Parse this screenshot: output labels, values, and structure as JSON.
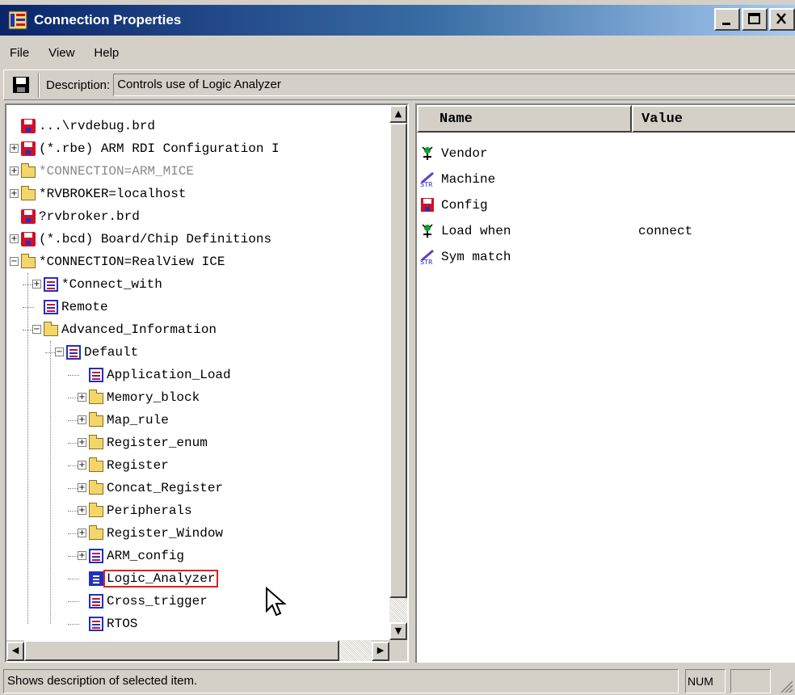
{
  "window": {
    "title": "Connection Properties"
  },
  "menu": [
    "File",
    "View",
    "Help"
  ],
  "toolbar": {
    "description_label": "Description:",
    "description_value": "Controls use of Logic Analyzer"
  },
  "tree": [
    {
      "label": "...\\rvdebug.brd",
      "icon": "red-board-icon",
      "depth": 0
    },
    {
      "label": "(*.rbe) ARM RDI Configuration I",
      "icon": "red-board-icon",
      "depth": 0,
      "expander": "+"
    },
    {
      "label": "*CONNECTION=ARM_MICE",
      "icon": "folder-icon",
      "depth": 0,
      "expander": "+",
      "grayed": true
    },
    {
      "label": "*RVBROKER=localhost",
      "icon": "folder-icon",
      "depth": 0,
      "expander": "+"
    },
    {
      "label": "?rvbroker.brd",
      "icon": "red-board-icon",
      "depth": 0
    },
    {
      "label": "(*.bcd) Board/Chip Definitions",
      "icon": "red-board-icon",
      "depth": 0,
      "expander": "+"
    },
    {
      "label": "*CONNECTION=RealView ICE",
      "icon": "folder-icon",
      "depth": 0,
      "expander": "-"
    },
    {
      "label": "*Connect_with",
      "icon": "document-icon",
      "depth": 1,
      "expander": "+"
    },
    {
      "label": "Remote",
      "icon": "document-icon",
      "depth": 1
    },
    {
      "label": "Advanced_Information",
      "icon": "folder-icon",
      "depth": 1,
      "expander": "-"
    },
    {
      "label": "Default",
      "icon": "document-icon",
      "depth": 2,
      "expander": "-"
    },
    {
      "label": "Application_Load",
      "icon": "document-icon",
      "depth": 3
    },
    {
      "label": "Memory_block",
      "icon": "folder-icon",
      "depth": 3,
      "expander": "+"
    },
    {
      "label": "Map_rule",
      "icon": "folder-icon",
      "depth": 3,
      "expander": "+"
    },
    {
      "label": "Register_enum",
      "icon": "folder-icon",
      "depth": 3,
      "expander": "+"
    },
    {
      "label": "Register",
      "icon": "folder-icon",
      "depth": 3,
      "expander": "+"
    },
    {
      "label": "Concat_Register",
      "icon": "folder-icon",
      "depth": 3,
      "expander": "+"
    },
    {
      "label": "Peripherals",
      "icon": "folder-icon",
      "depth": 3,
      "expander": "+"
    },
    {
      "label": "Register_Window",
      "icon": "folder-icon",
      "depth": 3,
      "expander": "+"
    },
    {
      "label": "ARM_config",
      "icon": "document-icon",
      "depth": 3,
      "expander": "+"
    },
    {
      "label": "Logic_Analyzer",
      "icon": "document-edit-icon",
      "depth": 3,
      "selected": true
    },
    {
      "label": "Cross_trigger",
      "icon": "document-icon",
      "depth": 3
    },
    {
      "label": "RTOS",
      "icon": "document-icon",
      "depth": 3
    }
  ],
  "list": {
    "columns": [
      "Name",
      "Value"
    ],
    "rows": [
      {
        "icon": "green-figure-icon",
        "name": "Vendor",
        "value": ""
      },
      {
        "icon": "string-icon",
        "name": "Machine",
        "value": ""
      },
      {
        "icon": "red-board-icon",
        "name": "Config",
        "value": ""
      },
      {
        "icon": "green-figure-icon",
        "name": "Load when",
        "value": "connect"
      },
      {
        "icon": "string-icon",
        "name": "Sym match",
        "value": ""
      }
    ]
  },
  "statusbar": {
    "text": "Shows description of selected item.",
    "num": "NUM",
    "extra": ""
  }
}
